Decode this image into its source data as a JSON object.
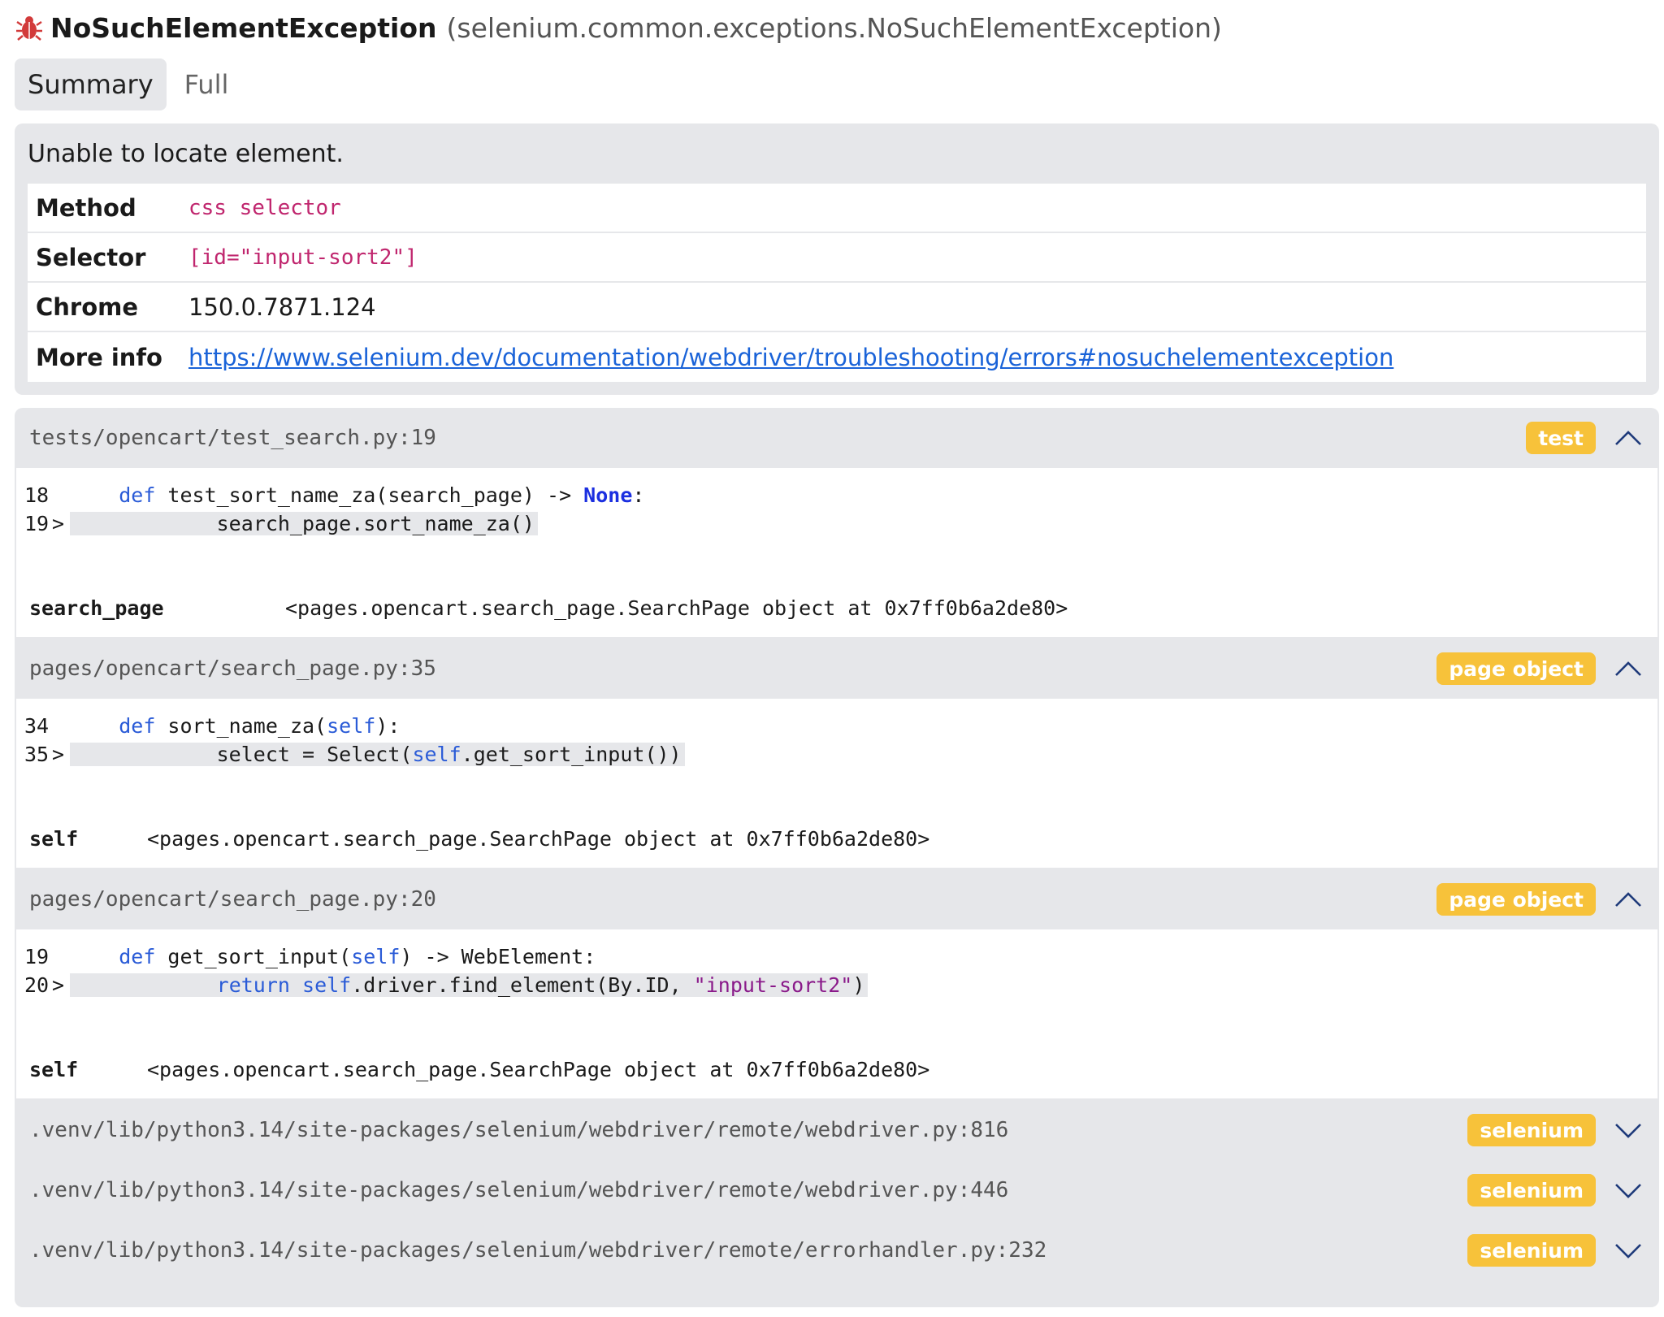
{
  "header": {
    "exception_name": "NoSuchElementException",
    "exception_qualified": "(selenium.common.exceptions.NoSuchElementException)"
  },
  "tabs": [
    {
      "label": "Summary",
      "active": true
    },
    {
      "label": "Full",
      "active": false
    }
  ],
  "summary": {
    "message": "Unable to locate element.",
    "rows": [
      {
        "key": "Method",
        "value": "css selector"
      },
      {
        "key": "Selector",
        "value": "[id=\"input-sort2\"]"
      },
      {
        "key": "Chrome",
        "value": "150.0.7871.124"
      },
      {
        "key": "More info",
        "value": "https://www.selenium.dev/documentation/webdriver/troubleshooting/errors#nosuchelementexception"
      }
    ]
  },
  "frames": [
    {
      "path": "tests/opencart/test_search.py:19",
      "tag": "test",
      "lines": [
        {
          "num": "18",
          "marker": "",
          "parts": [
            "def",
            " test_sort_name_za(search_page) -> ",
            "None",
            ":"
          ]
        },
        {
          "num": "19",
          "marker": ">",
          "parts": [
            "        search_page.sort_name_za()"
          ]
        }
      ],
      "var_name": "search_page",
      "var_value": "<pages.opencart.search_page.SearchPage object at 0x7ff0b6a2de80>"
    },
    {
      "path": "pages/opencart/search_page.py:35",
      "tag": "page object",
      "lines": [
        {
          "num": "34",
          "marker": "",
          "parts": [
            "def",
            " sort_name_za(",
            "self",
            "):"
          ]
        },
        {
          "num": "35",
          "marker": ">",
          "parts": [
            "        select = Select(",
            "self",
            ".get_sort_input())"
          ]
        }
      ],
      "var_name": "self",
      "var_value": "<pages.opencart.search_page.SearchPage object at 0x7ff0b6a2de80>"
    },
    {
      "path": "pages/opencart/search_page.py:20",
      "tag": "page object",
      "lines": [
        {
          "num": "19",
          "marker": "",
          "parts": [
            "def",
            " get_sort_input(",
            "self",
            ") -> WebElement:"
          ]
        },
        {
          "num": "20",
          "marker": ">",
          "parts": [
            "        ",
            "return",
            " ",
            "self",
            ".driver.find_element(By.ID, ",
            "\"input-sort2\"",
            ")"
          ]
        }
      ],
      "var_name": "self",
      "var_value": "<pages.opencart.search_page.SearchPage object at 0x7ff0b6a2de80>"
    }
  ],
  "collapsed_frames": [
    {
      "path": ".venv/lib/python3.14/site-packages/selenium/webdriver/remote/webdriver.py:816",
      "tag": "selenium"
    },
    {
      "path": ".venv/lib/python3.14/site-packages/selenium/webdriver/remote/webdriver.py:446",
      "tag": "selenium"
    },
    {
      "path": ".venv/lib/python3.14/site-packages/selenium/webdriver/remote/errorhandler.py:232",
      "tag": "selenium"
    }
  ],
  "colors": {
    "tag_bg": "#f7c23a",
    "panel_bg": "#e6e7ea",
    "link": "#1a63d8",
    "code_value": "#c0266e",
    "bug_icon": "#d23a3a"
  },
  "icons": {
    "exception": "bug-icon",
    "expanded": "chevron-up-icon",
    "collapsed": "chevron-down-icon"
  }
}
